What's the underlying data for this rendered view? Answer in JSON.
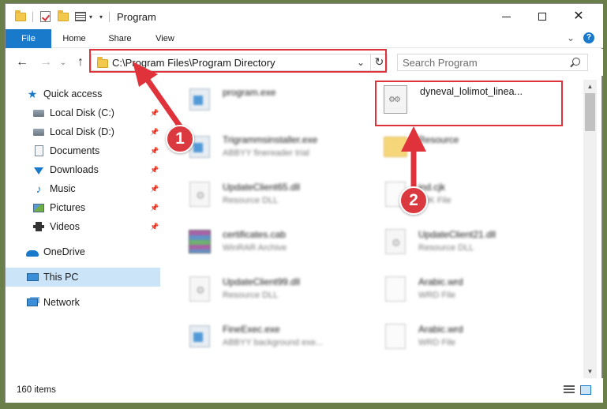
{
  "window": {
    "title": "Program"
  },
  "ribbon": {
    "tabs": [
      {
        "label": "File"
      },
      {
        "label": "Home"
      },
      {
        "label": "Share"
      },
      {
        "label": "View"
      }
    ]
  },
  "navbar": {
    "address_path": "C:\\Program Files\\Program Directory",
    "search_placeholder": "Search Program"
  },
  "sidebar": {
    "items": [
      {
        "label": "Quick access",
        "icon": "star-icon"
      },
      {
        "label": "Local Disk (C:)",
        "icon": "drive-icon"
      },
      {
        "label": "Local Disk (D:)",
        "icon": "drive-icon"
      },
      {
        "label": "Documents",
        "icon": "documents-icon"
      },
      {
        "label": "Downloads",
        "icon": "downloads-icon"
      },
      {
        "label": "Music",
        "icon": "music-icon"
      },
      {
        "label": "Pictures",
        "icon": "pictures-icon"
      },
      {
        "label": "Videos",
        "icon": "videos-icon"
      },
      {
        "label": "OneDrive",
        "icon": "onedrive-icon"
      },
      {
        "label": "This PC",
        "icon": "this-pc-icon"
      },
      {
        "label": "Network",
        "icon": "network-icon"
      }
    ]
  },
  "files": [
    {
      "name": "program.exe",
      "type": ""
    },
    {
      "name": "dyneval_lolimot_linea...",
      "type": ""
    },
    {
      "name": "Trigrammsinstaller.exe",
      "type": "ABBYY finereader trial"
    },
    {
      "name": "Resource",
      "type": ""
    },
    {
      "name": "UpdateClient65.dll",
      "type": "Resource DLL"
    },
    {
      "name": "ind.cjk",
      "type": "CJK File"
    },
    {
      "name": "certificates.cab",
      "type": "WinRAR Archive"
    },
    {
      "name": "UpdateClient21.dll",
      "type": "Resource DLL"
    },
    {
      "name": "UpdateClient99.dll",
      "type": "Resource DLL"
    },
    {
      "name": "Arabic.wrd",
      "type": "WRD File"
    },
    {
      "name": "FineExec.exe",
      "type": "ABBYY background exe..."
    },
    {
      "name": "Arabic.wrd",
      "type": "WRD File"
    }
  ],
  "status": {
    "item_count": "160 items"
  },
  "annotations": {
    "badge_1": "1",
    "badge_2": "2"
  },
  "colors": {
    "accent": "#1979ca",
    "highlight_red": "#e0323a",
    "badge_red": "#d9393f",
    "selection": "#cce4f7"
  }
}
